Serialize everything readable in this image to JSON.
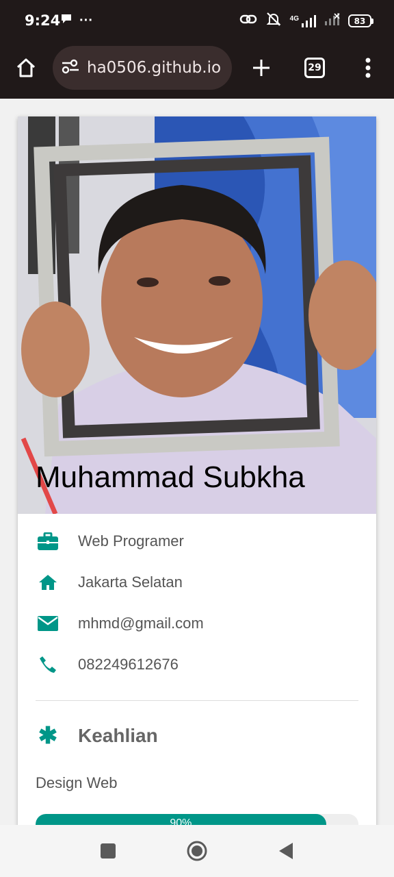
{
  "status_bar": {
    "time": "9:24",
    "battery": "83",
    "network": "4G"
  },
  "browser": {
    "url": "ha0506.github.io",
    "tab_count": "29"
  },
  "profile": {
    "name": "Muhammad Subkha",
    "info": [
      {
        "icon": "briefcase-icon",
        "text": "Web Programer"
      },
      {
        "icon": "home-icon",
        "text": "Jakarta Selatan"
      },
      {
        "icon": "envelope-icon",
        "text": "mhmd@gmail.com"
      },
      {
        "icon": "phone-icon",
        "text": "082249612676"
      }
    ],
    "skills_title": "Keahlian",
    "skills": [
      {
        "label": "Design Web",
        "percent_text": "90%",
        "level": 0.9
      }
    ]
  },
  "colors": {
    "accent": "#009688",
    "browser_bar": "#201919"
  }
}
